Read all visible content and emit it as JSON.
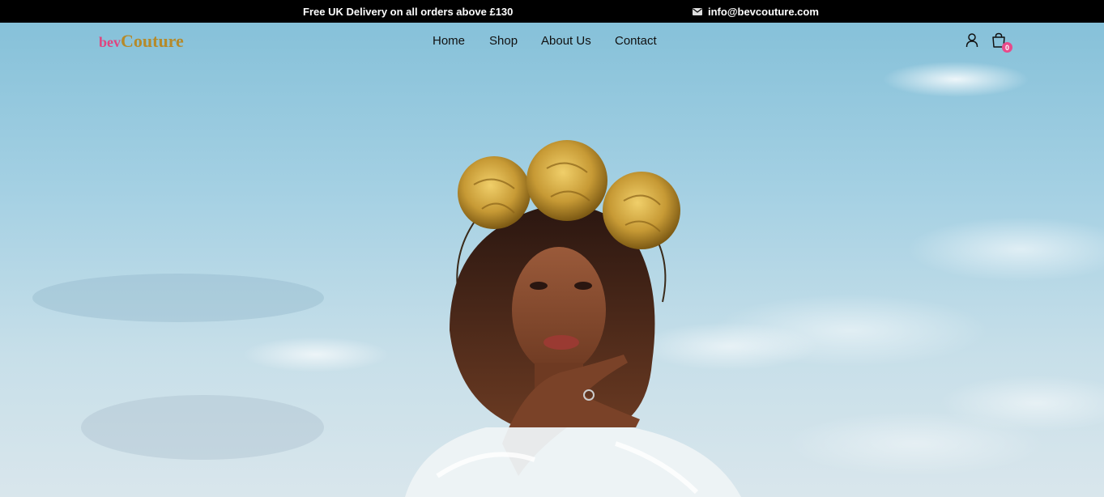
{
  "topbar": {
    "promo": "Free UK Delivery on all orders above £130",
    "email": "info@bevcouture.com",
    "email_icon": "envelope-icon"
  },
  "header": {
    "logo_part1": "bev",
    "logo_part2": "Couture",
    "nav": [
      "Home",
      "Shop",
      "About Us",
      "Contact"
    ],
    "account_icon": "user-icon",
    "cart_icon": "shopping-bag-icon",
    "cart_count": "0"
  },
  "hero": {
    "image": "woman-with-gold-flower-headpiece-against-sky"
  },
  "colors": {
    "topbar_bg": "#000000",
    "logo_bev": "#e0457f",
    "logo_couture": "#b58a2a",
    "cart_badge": "#e84a8a"
  }
}
